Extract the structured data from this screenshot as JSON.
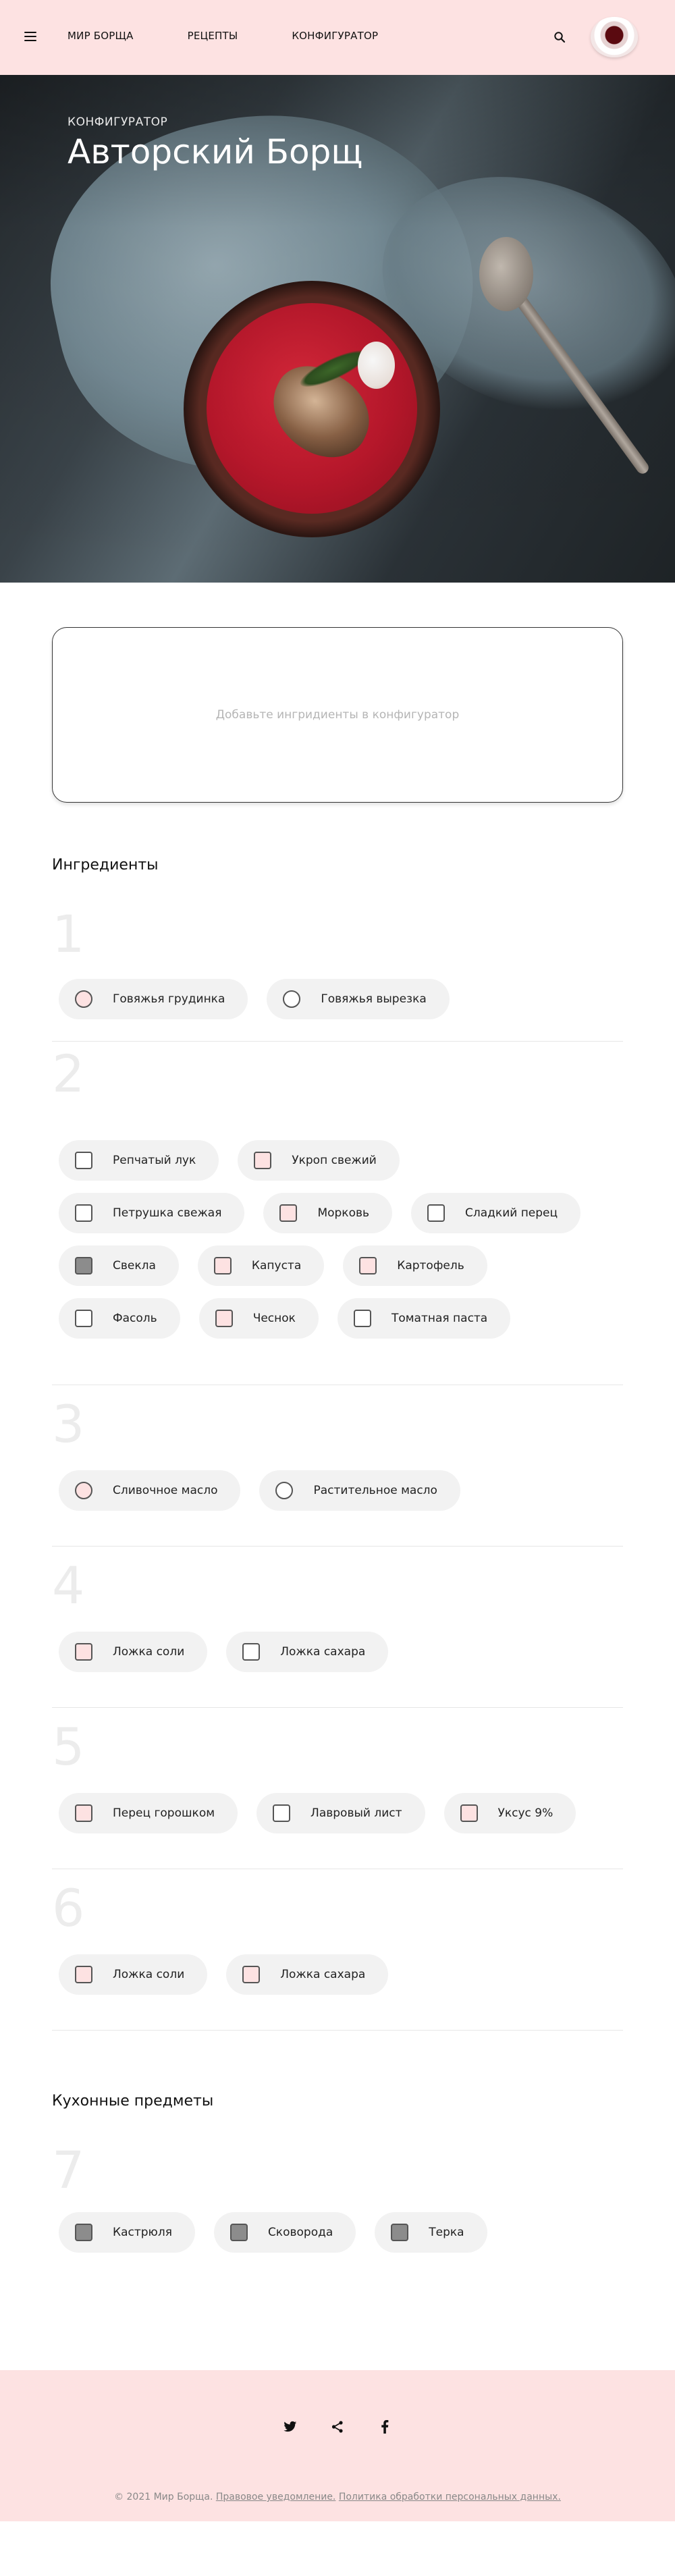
{
  "header": {
    "nav": [
      "МИР БОРЩА",
      "РЕЦЕПТЫ",
      "КОНФИГУРАТОР"
    ],
    "icons": {
      "menu": "hamburger-icon",
      "search": "search-icon",
      "logo": "borscht-bowl-logo"
    }
  },
  "hero": {
    "subtitle": "КОНФИГУРАТОР",
    "title": "Авторский Борщ"
  },
  "configurator": {
    "placeholder": "Добавьте ингридиенты в конфигуратор"
  },
  "sections": {
    "ingredients_title": "Ингредиенты",
    "kitchen_title": "Кухонные предметы"
  },
  "groups": [
    {
      "number": "1",
      "items": [
        {
          "label": "Говяжья грудинка",
          "shape": "round",
          "fill": "#fde2e2"
        },
        {
          "label": "Говяжья вырезка",
          "shape": "round",
          "fill": "#ffffff"
        }
      ]
    },
    {
      "number": "2",
      "items": [
        {
          "label": "Репчатый лук",
          "shape": "square",
          "fill": "#ffffff"
        },
        {
          "label": "Укроп свежий",
          "shape": "square",
          "fill": "#fde2e2"
        },
        {
          "label": "Петрушка свежая",
          "shape": "square",
          "fill": "#ffffff"
        },
        {
          "label": "Морковь",
          "shape": "square",
          "fill": "#fde2e2"
        },
        {
          "label": "Сладкий перец",
          "shape": "square",
          "fill": "#ffffff"
        },
        {
          "label": "Свекла",
          "shape": "square",
          "fill": "#8c8c8c"
        },
        {
          "label": "Капуста",
          "shape": "square",
          "fill": "#fde2e2"
        },
        {
          "label": "Картофель",
          "shape": "square",
          "fill": "#fde2e2"
        },
        {
          "label": "Фасоль",
          "shape": "square",
          "fill": "#ffffff"
        },
        {
          "label": "Чеснок",
          "shape": "square",
          "fill": "#fde2e2"
        },
        {
          "label": "Томатная паста",
          "shape": "square",
          "fill": "#ffffff"
        }
      ]
    },
    {
      "number": "3",
      "items": [
        {
          "label": "Сливочное масло",
          "shape": "round",
          "fill": "#fde2e2"
        },
        {
          "label": "Растительное масло",
          "shape": "round",
          "fill": "#ffffff"
        }
      ]
    },
    {
      "number": "4",
      "items": [
        {
          "label": "Ложка соли",
          "shape": "square",
          "fill": "#fde2e2"
        },
        {
          "label": "Ложка сахара",
          "shape": "square",
          "fill": "#ffffff"
        }
      ]
    },
    {
      "number": "5",
      "items": [
        {
          "label": "Перец горошком",
          "shape": "square",
          "fill": "#fde2e2"
        },
        {
          "label": "Лавровый лист",
          "shape": "square",
          "fill": "#ffffff"
        },
        {
          "label": "Уксус 9%",
          "shape": "square",
          "fill": "#fde2e2"
        }
      ]
    },
    {
      "number": "6",
      "items": [
        {
          "label": "Ложка соли",
          "shape": "square",
          "fill": "#fde2e2"
        },
        {
          "label": "Ложка сахара",
          "shape": "square",
          "fill": "#fde2e2"
        }
      ]
    }
  ],
  "kitchen_group": {
    "number": "7",
    "items": [
      {
        "label": "Кастрюля",
        "shape": "square",
        "fill": "#8c8c8c"
      },
      {
        "label": "Сковорода",
        "shape": "square",
        "fill": "#8c8c8c"
      },
      {
        "label": "Терка",
        "shape": "square",
        "fill": "#8c8c8c"
      }
    ]
  },
  "footer": {
    "social_icons": [
      "twitter-icon",
      "share-icon",
      "facebook-icon"
    ],
    "copyright_prefix": "© 2021 Мир Борща.",
    "legal_link": "Правовое уведомление.",
    "privacy_link": "Политика обработки персональных данных."
  },
  "colors": {
    "accent": "#fde2e2",
    "chip": "#f2f2f2",
    "selected": "#8c8c8c"
  }
}
